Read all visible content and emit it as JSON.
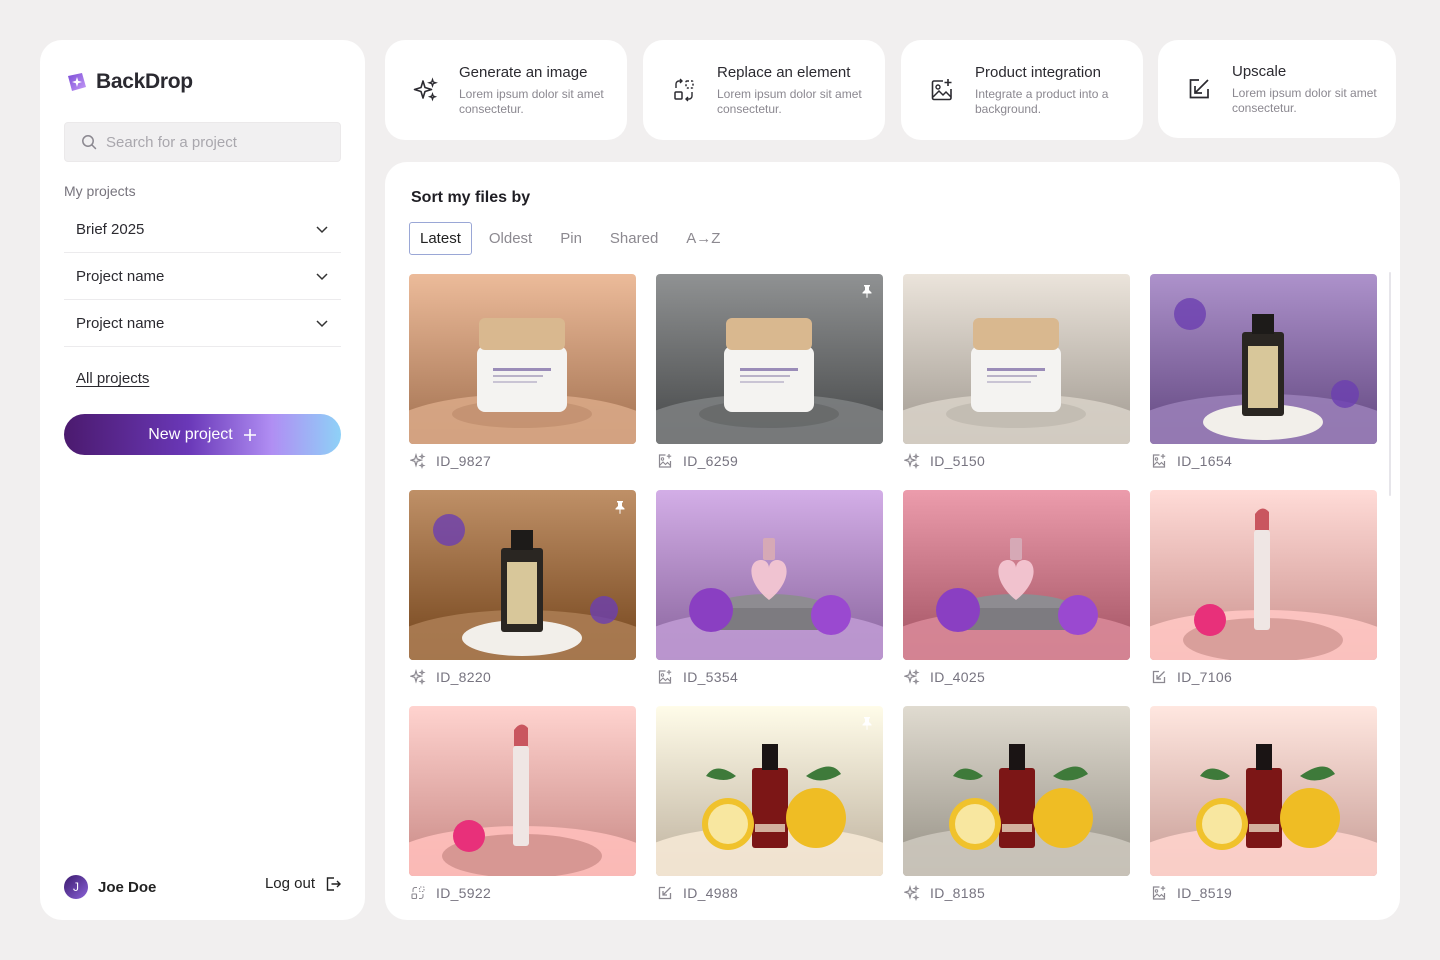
{
  "app": {
    "name": "BackDrop"
  },
  "sidebar": {
    "search_placeholder": "Search for a project",
    "section_label": "My projects",
    "projects": [
      {
        "label": "Brief 2025"
      },
      {
        "label": "Project name"
      },
      {
        "label": "Project name"
      }
    ],
    "all_projects_label": "All projects",
    "new_project_label": "New project",
    "user": {
      "initial": "J",
      "name": "Joe Doe"
    },
    "logout_label": "Log out"
  },
  "actions": [
    {
      "title": "Generate an image",
      "desc": "Lorem ipsum dolor sit amet consectetur.",
      "icon": "sparkles-icon"
    },
    {
      "title": "Replace an element",
      "desc": "Lorem ipsum dolor sit amet consectetur.",
      "icon": "replace-icon"
    },
    {
      "title": "Product integration",
      "desc": "Integrate a product into a background.",
      "icon": "image-plus-icon"
    },
    {
      "title": "Upscale",
      "desc": "Lorem ipsum dolor sit amet consectetur.",
      "icon": "upscale-icon"
    }
  ],
  "main": {
    "title": "Sort my files by",
    "tabs": [
      "Latest",
      "Oldest",
      "Pin",
      "Shared",
      "A→Z"
    ],
    "active_tab": "Latest"
  },
  "files": [
    {
      "id": "ID_9827",
      "type": "generate",
      "pinned": false,
      "scene": "jar",
      "bg": "#c99877"
    },
    {
      "id": "ID_6259",
      "type": "integration",
      "pinned": true,
      "scene": "jar",
      "bg": "#6d6f70"
    },
    {
      "id": "ID_5150",
      "type": "generate",
      "pinned": false,
      "scene": "jar",
      "bg": "#c8c1b8"
    },
    {
      "id": "ID_1654",
      "type": "integration",
      "pinned": false,
      "scene": "perfume",
      "bg": "#8a6fa8"
    },
    {
      "id": "ID_8220",
      "type": "generate",
      "pinned": true,
      "scene": "perfume",
      "bg": "#9c6d44"
    },
    {
      "id": "ID_5354",
      "type": "integration",
      "pinned": false,
      "scene": "heart",
      "bg": "#b08bc4"
    },
    {
      "id": "ID_4025",
      "type": "generate",
      "pinned": false,
      "scene": "heart",
      "bg": "#c97989"
    },
    {
      "id": "ID_7106",
      "type": "upscale",
      "pinned": false,
      "scene": "lipstick",
      "bg": "#f2b8b4"
    },
    {
      "id": "ID_5922",
      "type": "replace",
      "pinned": false,
      "scene": "lipstick",
      "bg": "#f0b0ac"
    },
    {
      "id": "ID_4988",
      "type": "upscale",
      "pinned": true,
      "scene": "serum",
      "bg": "#e6d9c6"
    },
    {
      "id": "ID_8185",
      "type": "generate",
      "pinned": false,
      "scene": "serum",
      "bg": "#bdb8ad"
    },
    {
      "id": "ID_8519",
      "type": "integration",
      "pinned": false,
      "scene": "serum",
      "bg": "#efc4bd"
    }
  ]
}
